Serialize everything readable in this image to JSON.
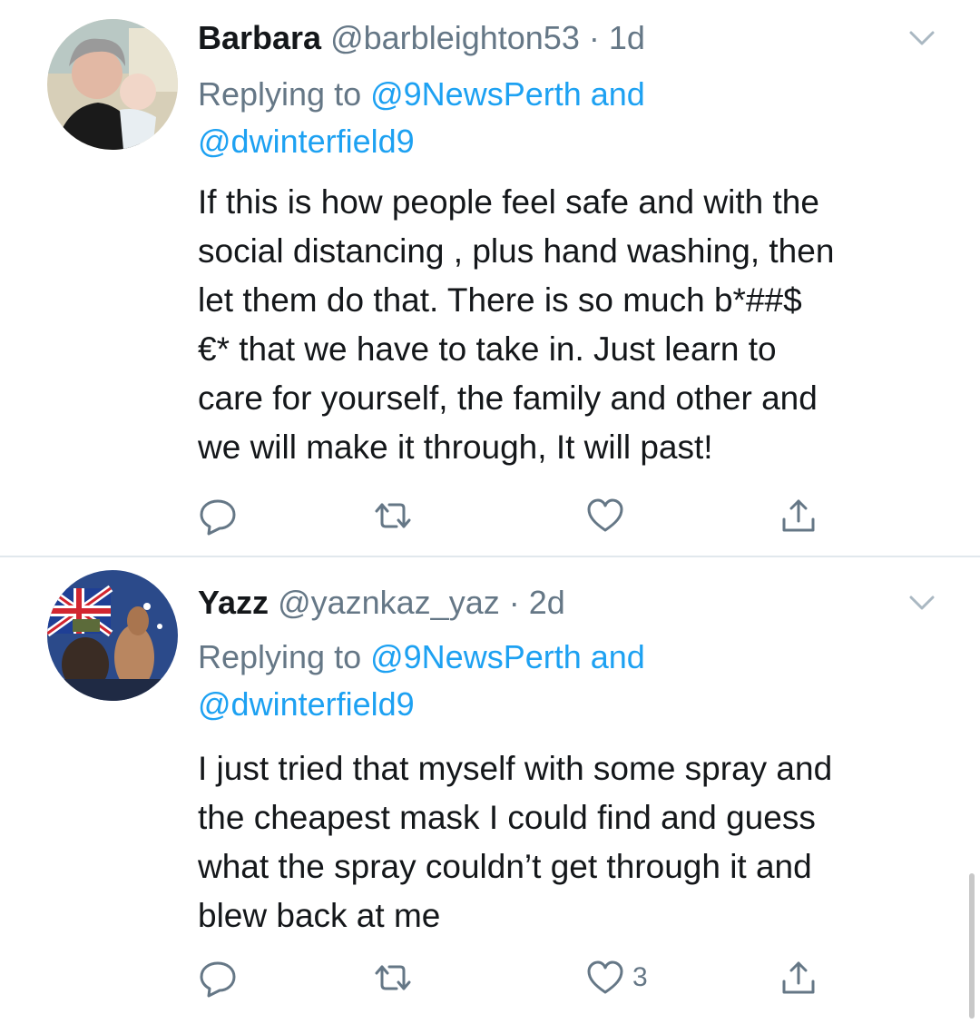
{
  "tweets": [
    {
      "name": "Barbara",
      "handle": "@barbleighton53",
      "separator": "·",
      "time": "1d",
      "replying_prefix": "Replying to ",
      "replying_to_1": "@9NewsPerth",
      "replying_and": " and",
      "replying_to_2": "@dwinterfield9",
      "body": "If this is how people feel safe and with the\nsocial distancing , plus hand washing, then\nlet them do that. There is so much b*##$\n€* that we have to take in. Just learn to\ncare for yourself, the family and other and\nwe will make it through, It will past!",
      "like_count": "",
      "avatar_icon": "user-photo-avatar"
    },
    {
      "name": "Yazz",
      "handle": "@yaznkaz_yaz",
      "separator": "·",
      "time": "2d",
      "replying_prefix": "Replying to ",
      "replying_to_1": "@9NewsPerth",
      "replying_and": " and",
      "replying_to_2": "@dwinterfield9",
      "body": "I just tried that myself with some spray and\nthe cheapest mask I could find and guess\nwhat the spray couldn’t get through it and\nblew back at me",
      "like_count": "3",
      "avatar_icon": "illustrated-avatar"
    }
  ],
  "icons": {
    "reply": "reply-icon",
    "retweet": "retweet-icon",
    "like": "heart-icon",
    "share": "share-icon",
    "menu": "chevron-down-icon"
  },
  "colors": {
    "link": "#1da1f2",
    "secondary_text": "#657786",
    "primary_text": "#14171a",
    "divider": "#e1e8ed"
  }
}
